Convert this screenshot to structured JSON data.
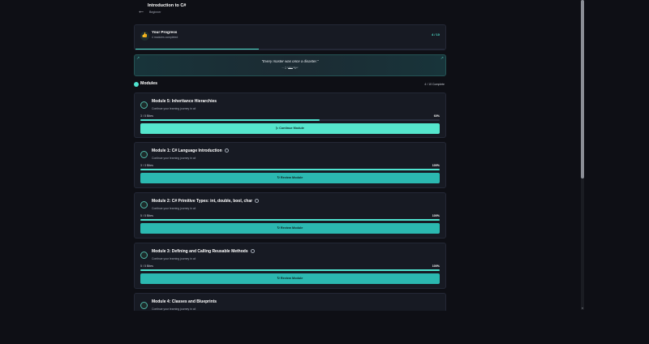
{
  "header": {
    "course_title": "Introduction to C#",
    "course_level": "Beginner"
  },
  "progress": {
    "label": "Your Progress",
    "sub": "4 modules completed",
    "count": "4 / 10",
    "fraction": 0.4
  },
  "quote": {
    "text": "\"Every master was once a disaster.\"",
    "author": "— T. Harv Eker",
    "slides": 3,
    "active_slide": 1
  },
  "modules_section": {
    "title": "Modules",
    "count": "4 / 10 Complete"
  },
  "modules": [
    {
      "title": "Module 5: Inheritance Hierarchies",
      "desc": "Continue your learning journey in c#",
      "bites": "3 / 5 Bites",
      "pct": "60%",
      "fraction": 0.6,
      "button": "Continue Module",
      "button_icon": "play-icon",
      "completed": false
    },
    {
      "title": "Module 1: C# Language Introduction",
      "desc": "Continue your learning journey in c#",
      "bites": "3 / 3 Bites",
      "pct": "100%",
      "fraction": 1,
      "button": "Review Module",
      "button_icon": "refresh-icon",
      "completed": true
    },
    {
      "title": "Module 2: C# Primitive Types: int, double, bool, char",
      "desc": "Continue your learning journey in c#",
      "bites": "5 / 5 Bites",
      "pct": "100%",
      "fraction": 1,
      "button": "Review Module",
      "button_icon": "refresh-icon",
      "completed": true
    },
    {
      "title": "Module 3: Defining and Calling Reusable Methods",
      "desc": "Continue your learning journey in c#",
      "bites": "5 / 5 Bites",
      "pct": "100%",
      "fraction": 1,
      "button": "Review Module",
      "button_icon": "refresh-icon",
      "completed": true
    },
    {
      "title": "Module 4: Classes and Blueprints",
      "desc": "Continue your learning journey in c#",
      "bites": "",
      "pct": "",
      "fraction": 1,
      "button": "",
      "button_icon": "",
      "completed": false
    }
  ],
  "colors": {
    "accent": "#4fe3cf",
    "review_button": "#2bb8b0",
    "continue_button": "#55e6cd"
  }
}
